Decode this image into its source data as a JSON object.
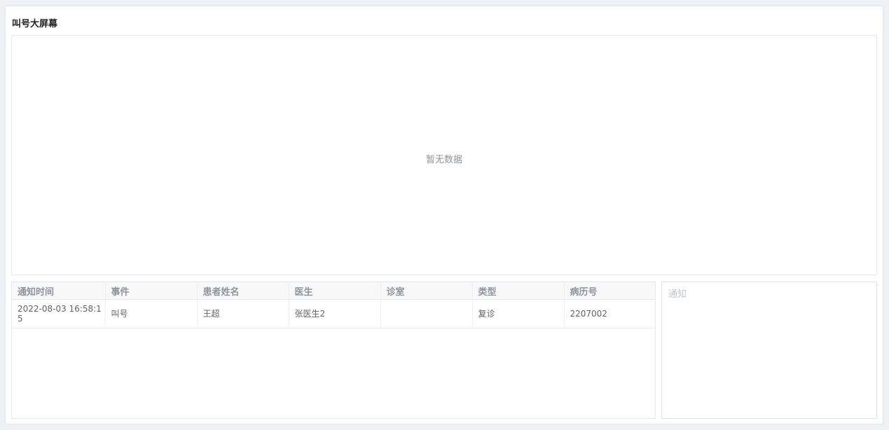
{
  "page": {
    "title": "叫号大屏幕"
  },
  "screen": {
    "empty_text": "暂无数据"
  },
  "table": {
    "columns": [
      "通知时间",
      "事件",
      "患者姓名",
      "医生",
      "诊室",
      "类型",
      "病历号"
    ],
    "rows": [
      [
        "2022-08-03 16:58:15",
        "叫号",
        "王超",
        "张医生2",
        "",
        "复诊",
        "2207002"
      ]
    ]
  },
  "notify": {
    "placeholder": "通知",
    "value": ""
  }
}
